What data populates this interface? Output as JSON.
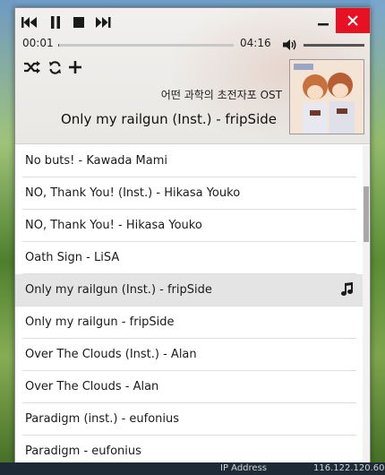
{
  "window": {
    "close_label": "✕",
    "minimize_label": "—"
  },
  "player": {
    "time_current": "00:01",
    "time_total": "04:16",
    "progress_fraction": 0.004,
    "volume_fraction": 1.0,
    "album": "어떤 과학의 초전자포 OST",
    "now_playing": "Only my railgun (Inst.) - fripSide",
    "icons": [
      "previous-icon",
      "pause-icon",
      "stop-icon",
      "next-icon",
      "shuffle-icon",
      "repeat-icon",
      "add-icon",
      "volume-icon"
    ]
  },
  "playlist": {
    "items": [
      {
        "label": "No buts! - Kawada Mami",
        "active": false
      },
      {
        "label": "NO, Thank You! (Inst.) - Hikasa Youko",
        "active": false
      },
      {
        "label": "NO, Thank You! - Hikasa Youko",
        "active": false
      },
      {
        "label": "Oath Sign - LiSA",
        "active": false
      },
      {
        "label": "Only my railgun (Inst.) - fripSide",
        "active": true
      },
      {
        "label": "Only my railgun - fripSide",
        "active": false
      },
      {
        "label": "Over The Clouds (Inst.) - Alan",
        "active": false
      },
      {
        "label": "Over The Clouds - Alan",
        "active": false
      },
      {
        "label": "Paradigm (inst.) - eufonius",
        "active": false
      },
      {
        "label": "Paradigm - eufonius",
        "active": false
      }
    ]
  },
  "taskbar": {
    "ip_label": "IP Address",
    "ip_value": "116.122.120.60"
  },
  "colors": {
    "close_button": "#e81123",
    "active_row": "#e4e4e4",
    "header_bg": "#eeedeb"
  }
}
